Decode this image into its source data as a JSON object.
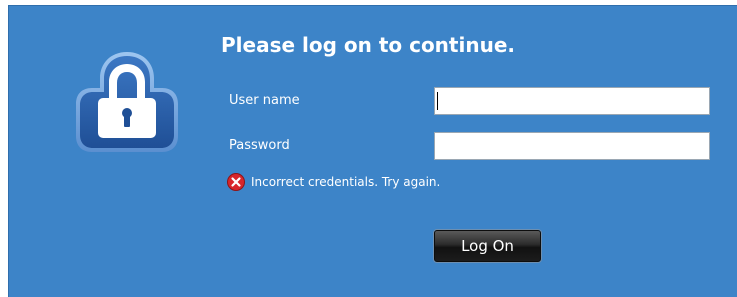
{
  "dialog": {
    "title": "Please log on to continue.",
    "username_label": "User name",
    "password_label": "Password",
    "username_value": "",
    "password_value": "",
    "error_message": "Incorrect credentials. Try again.",
    "logon_button_label": "Log On",
    "lock_icon": "padlock-icon",
    "error_icon": "error-x-icon"
  },
  "colors": {
    "panel_background": "#3d84c8",
    "lock_background": "#2b5ea8",
    "error_icon": "#d8262b",
    "button_background": "#1c1c1c",
    "text": "#ffffff"
  }
}
